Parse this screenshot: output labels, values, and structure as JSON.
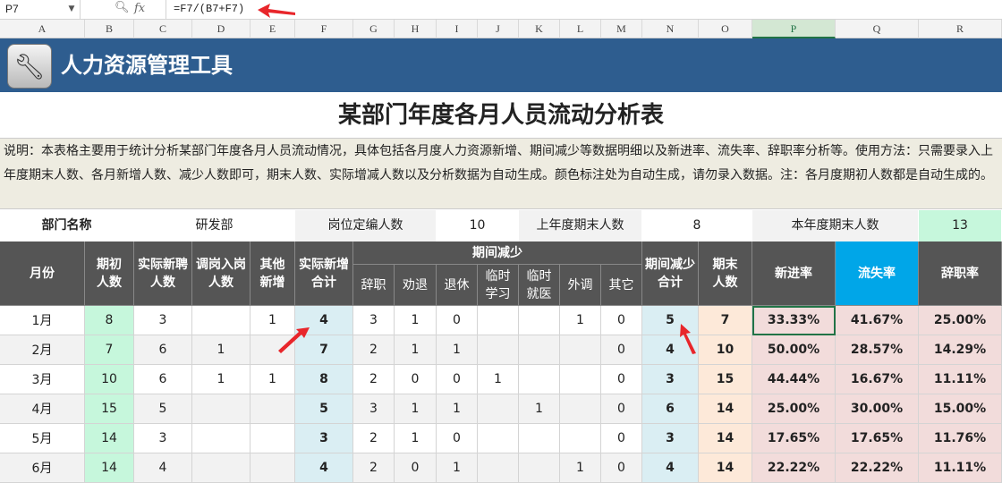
{
  "formula_bar": {
    "name_box": "P7",
    "formula": "=F7/(B7+F7)",
    "fx_label": "fx"
  },
  "columns": [
    "A",
    "B",
    "C",
    "D",
    "E",
    "F",
    "G",
    "H",
    "I",
    "J",
    "K",
    "L",
    "M",
    "N",
    "O",
    "P",
    "Q",
    "R"
  ],
  "active_column": "P",
  "banner": {
    "title": "人力资源管理工具"
  },
  "sheet_title": "某部门年度各月人员流动分析表",
  "description": "说明：本表格主要用于统计分析某部门年度各月人员流动情况，具体包括各月度人力资源新增、期间减少等数据明细以及新进率、流失率、辞职率分析等。使用方法：只需要录入上年度期末人数、各月新增人数、减少人数即可，期末人数、实际增减人数以及分析数据为自动生成。颜色标注处为自动生成，请勿录入数据。注：各月度期初人数都是自动生成的。",
  "info": {
    "dept_label": "部门名称",
    "dept_value": "研发部",
    "quota_label": "岗位定编人数",
    "quota_value": "10",
    "prev_label": "上年度期末人数",
    "prev_value": "8",
    "end_label": "本年度期末人数",
    "end_value": "13"
  },
  "headers": {
    "month": "月份",
    "begin": "期初人数",
    "new_hire": "实际新聘人数",
    "transfer_in": "调岗入岗人数",
    "other_add": "其他新增",
    "add_total": "实际新增合计",
    "decrease_group": "期间减少",
    "resign": "辞职",
    "dismiss": "劝退",
    "retire": "退休",
    "temp_study": "临时学习",
    "temp_medical": "临时就医",
    "transfer_out": "外调",
    "other_dec": "其它",
    "dec_total": "期间减少合计",
    "end": "期末人数",
    "new_rate": "新进率",
    "loss_rate": "流失率",
    "resign_rate": "辞职率"
  },
  "rows": [
    [
      "1月",
      "8",
      "3",
      "",
      "1",
      "4",
      "3",
      "1",
      "0",
      "",
      "",
      "1",
      "0",
      "5",
      "7",
      "33.33%",
      "41.67%",
      "25.00%"
    ],
    [
      "2月",
      "7",
      "6",
      "1",
      "",
      "7",
      "2",
      "1",
      "1",
      "",
      "",
      "",
      "0",
      "4",
      "10",
      "50.00%",
      "28.57%",
      "14.29%"
    ],
    [
      "3月",
      "10",
      "6",
      "1",
      "1",
      "8",
      "2",
      "0",
      "0",
      "1",
      "",
      "",
      "0",
      "3",
      "15",
      "44.44%",
      "16.67%",
      "11.11%"
    ],
    [
      "4月",
      "15",
      "5",
      "",
      "",
      "5",
      "3",
      "1",
      "1",
      "",
      "1",
      "",
      "0",
      "6",
      "14",
      "25.00%",
      "30.00%",
      "15.00%"
    ],
    [
      "5月",
      "14",
      "3",
      "",
      "",
      "3",
      "2",
      "1",
      "0",
      "",
      "",
      "",
      "0",
      "3",
      "14",
      "17.65%",
      "17.65%",
      "11.76%"
    ],
    [
      "6月",
      "14",
      "4",
      "",
      "",
      "4",
      "2",
      "0",
      "1",
      "",
      "",
      "1",
      "0",
      "4",
      "14",
      "22.22%",
      "22.22%",
      "11.11%"
    ]
  ],
  "colors": {
    "banner": "#2e5d8f",
    "header": "#555555",
    "accent_cyan": "#00a6e8",
    "selection": "#217346",
    "arrow": "#e8262b"
  }
}
